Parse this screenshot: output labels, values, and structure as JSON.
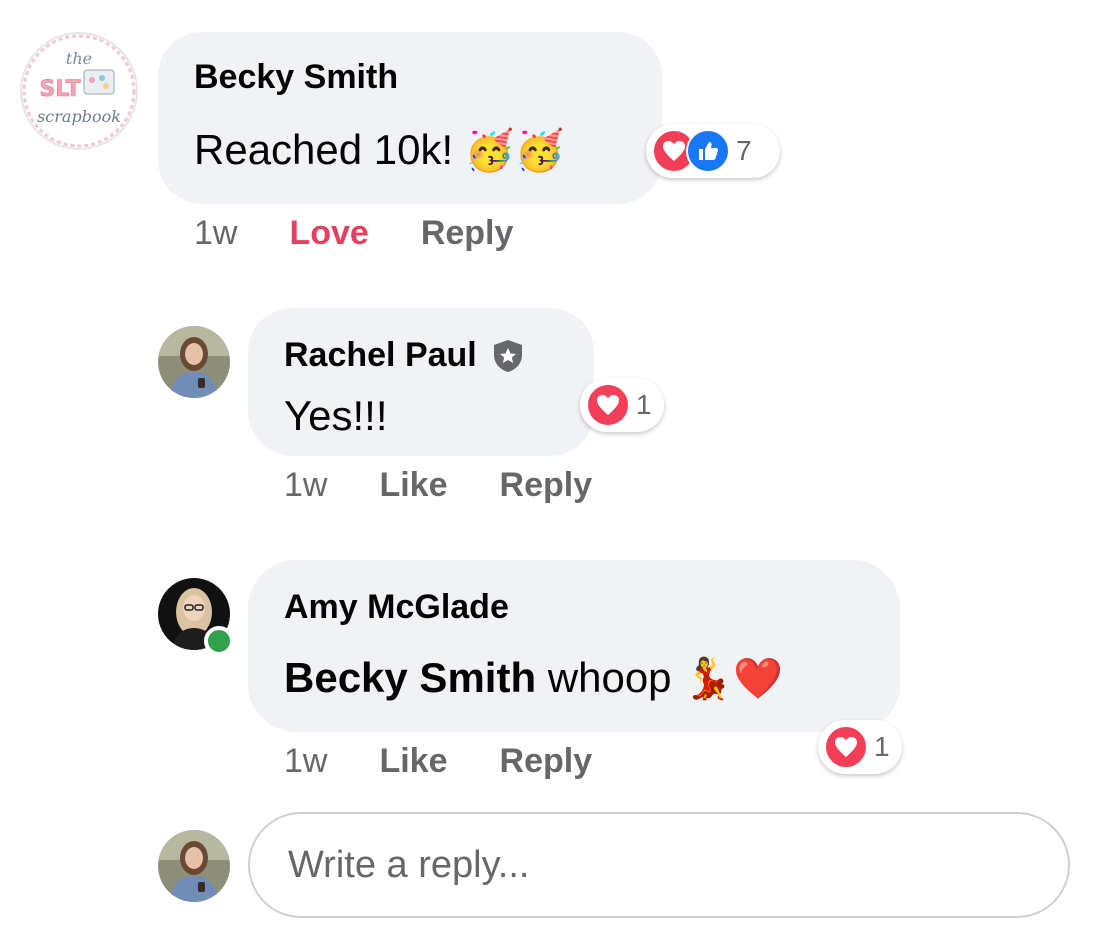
{
  "comments": [
    {
      "author": "Becky Smith",
      "text": "Reached 10k! ",
      "emoji": "🥳🥳",
      "reaction_count": "7",
      "time": "1w",
      "reaction_action": "Love",
      "reply_label": "Reply",
      "avatar_logo": "the SLT scrapbook"
    },
    {
      "author": "Rachel Paul",
      "text": "Yes!!!",
      "reaction_count": "1",
      "time": "1w",
      "like_label": "Like",
      "reply_label": "Reply"
    },
    {
      "author": "Amy McGlade",
      "mention": "Becky Smith",
      "text": " whoop ",
      "emoji": "💃❤️",
      "reaction_count": "1",
      "time": "1w",
      "like_label": "Like",
      "reply_label": "Reply"
    }
  ],
  "reply_input": {
    "placeholder": "Write a reply..."
  },
  "colors": {
    "bubble": "#f0f2f5",
    "love": "#e4405f",
    "secondary_text": "#65676b",
    "like_blue": "#1877f2",
    "heart_red": "#f33e58",
    "online_green": "#31a24c"
  },
  "icons": [
    "heart-reaction-icon",
    "like-reaction-icon",
    "admin-shield-icon",
    "online-status-icon"
  ]
}
